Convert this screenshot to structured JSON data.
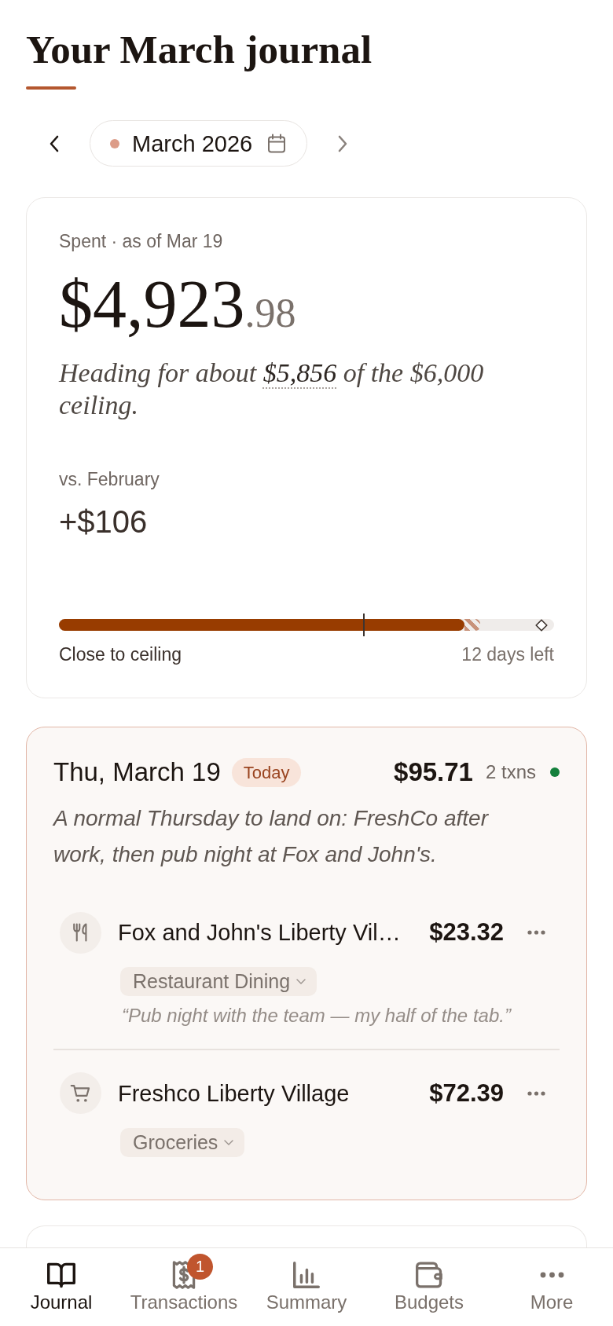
{
  "header": {
    "title": "Your March journal"
  },
  "month_picker": {
    "label": "March 2026"
  },
  "spent_card": {
    "caption": "Spent · as of Mar 19",
    "amount_whole": "$4,923",
    "amount_cents": ".98",
    "projection": {
      "before": "Heading for about ",
      "amount": "$5,856",
      "after": " of the $6,000 ceiling."
    },
    "comparison_label": "vs. February",
    "comparison_value": "+$106",
    "progress": {
      "level": 0.819,
      "markers": [
        {
          "kind": "pace",
          "level": 0.851
        },
        {
          "kind": "today",
          "level": 0.616
        },
        {
          "kind": "projection",
          "level": 0.975
        }
      ]
    },
    "status": "Close to ceiling",
    "days_left": "12 days left"
  },
  "days": [
    {
      "date": "Thu, March 19",
      "badge": "Today",
      "highlighted": true,
      "total": "$95.71",
      "count": "2 txns",
      "color": "#14803c",
      "summary": "A normal Thursday to land on: FreshCo after work, then pub night at Fox and John's.",
      "transactions": [
        {
          "merchant": "Fox and John's Liberty Vil…",
          "amount": "$23.32",
          "category": "Restaurant Dining",
          "note": "“Pub night with the team — my half of the tab.”"
        },
        {
          "merchant": "Freshco Liberty Village",
          "amount": "$72.39",
          "category": "Groceries"
        }
      ]
    }
  ],
  "tab_bar": {
    "tabs": [
      {
        "label": "Journal",
        "selected": true
      },
      {
        "label": "Transactions",
        "selected": false,
        "badge": "1"
      },
      {
        "label": "Summary",
        "selected": false
      },
      {
        "label": "Budgets",
        "selected": false
      },
      {
        "label": "More",
        "selected": false
      }
    ]
  }
}
